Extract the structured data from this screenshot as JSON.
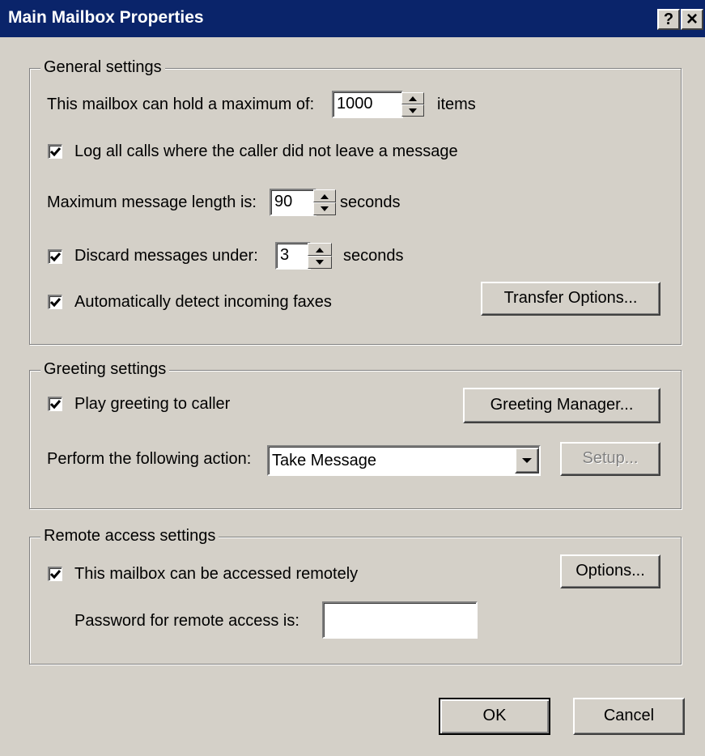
{
  "window": {
    "title": "Main Mailbox Properties",
    "help_glyph": "?",
    "close_glyph": "×"
  },
  "general": {
    "legend": "General settings",
    "max_label": "This mailbox can hold a maximum of:",
    "max_value": "1000",
    "max_unit": "items",
    "log_calls": {
      "label": "Log all calls where the caller did not leave a message",
      "checked": true
    },
    "length_label": "Maximum message length is:",
    "length_value": "90",
    "length_unit": "seconds",
    "discard": {
      "label": "Discard messages under:",
      "checked": true,
      "value": "3",
      "unit": "seconds"
    },
    "faxes": {
      "label": "Automatically detect incoming faxes",
      "checked": true
    },
    "transfer_button": "Transfer Options..."
  },
  "greeting": {
    "legend": "Greeting settings",
    "play": {
      "label": "Play greeting to caller",
      "checked": true
    },
    "manager_button": "Greeting Manager...",
    "action_label": "Perform the following action:",
    "action_value": "Take Message",
    "setup_button": "Setup..."
  },
  "remote": {
    "legend": "Remote access settings",
    "access": {
      "label": "This mailbox can be accessed remotely",
      "checked": true
    },
    "options_button": "Options...",
    "password_label": "Password for remote access is:",
    "password_value": ""
  },
  "footer": {
    "ok_button": "OK",
    "cancel_button": "Cancel"
  },
  "icons": {
    "checkmark": "check-icon",
    "spin_up": "spin-up-icon",
    "spin_down": "spin-down-icon",
    "dropdown": "chevron-down-icon"
  },
  "colors": {
    "titlebar": "#0a246a",
    "dialog_bg": "#d4d0c8"
  }
}
